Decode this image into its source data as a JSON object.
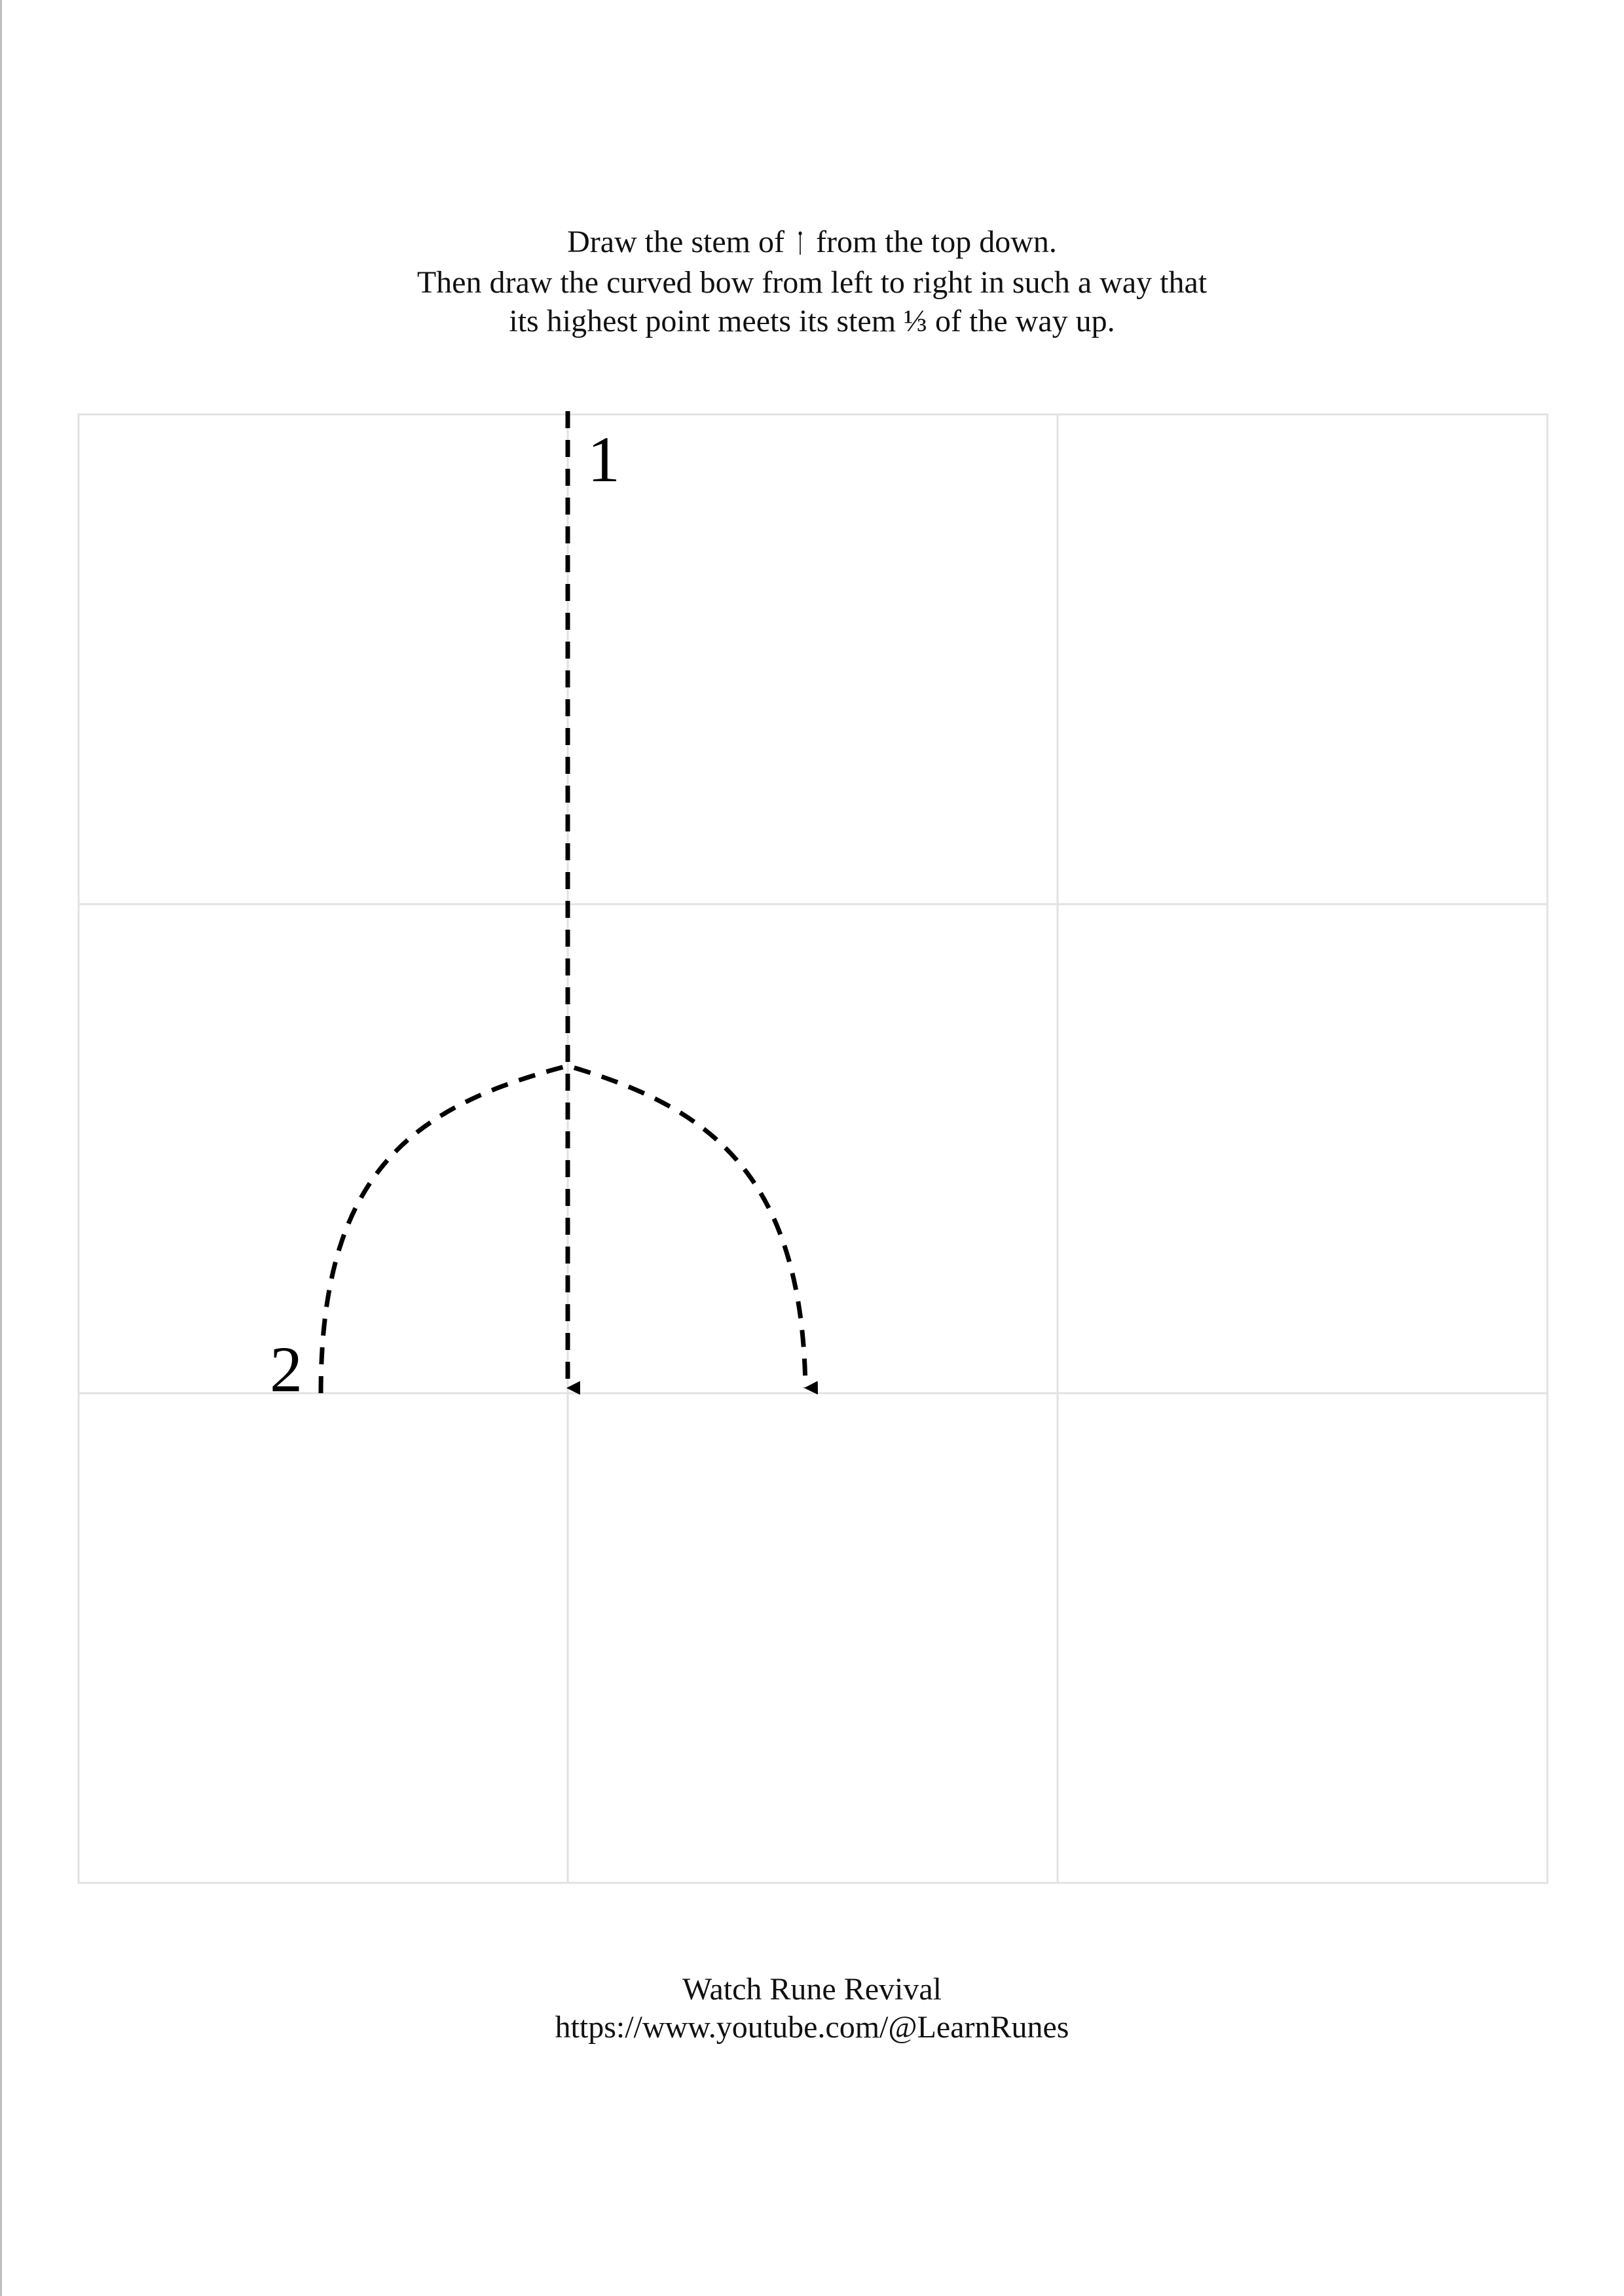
{
  "instructions": {
    "line1_before": "Draw the stem of ",
    "rune_glyph": "ᛙ",
    "line1_after": " from the top down.",
    "line2": "Then draw the curved bow from left to right in such a way that",
    "line3": "its highest point meets its stem ⅓ of the way up."
  },
  "stroke_labels": {
    "stroke1": "1",
    "stroke2": "2"
  },
  "footer": {
    "title": "Watch Rune Revival",
    "url": "https://www.youtube.com/@LearnRunes"
  },
  "colors": {
    "grid": "#e2e2e2",
    "stroke": "#000000",
    "text": "#111111"
  }
}
